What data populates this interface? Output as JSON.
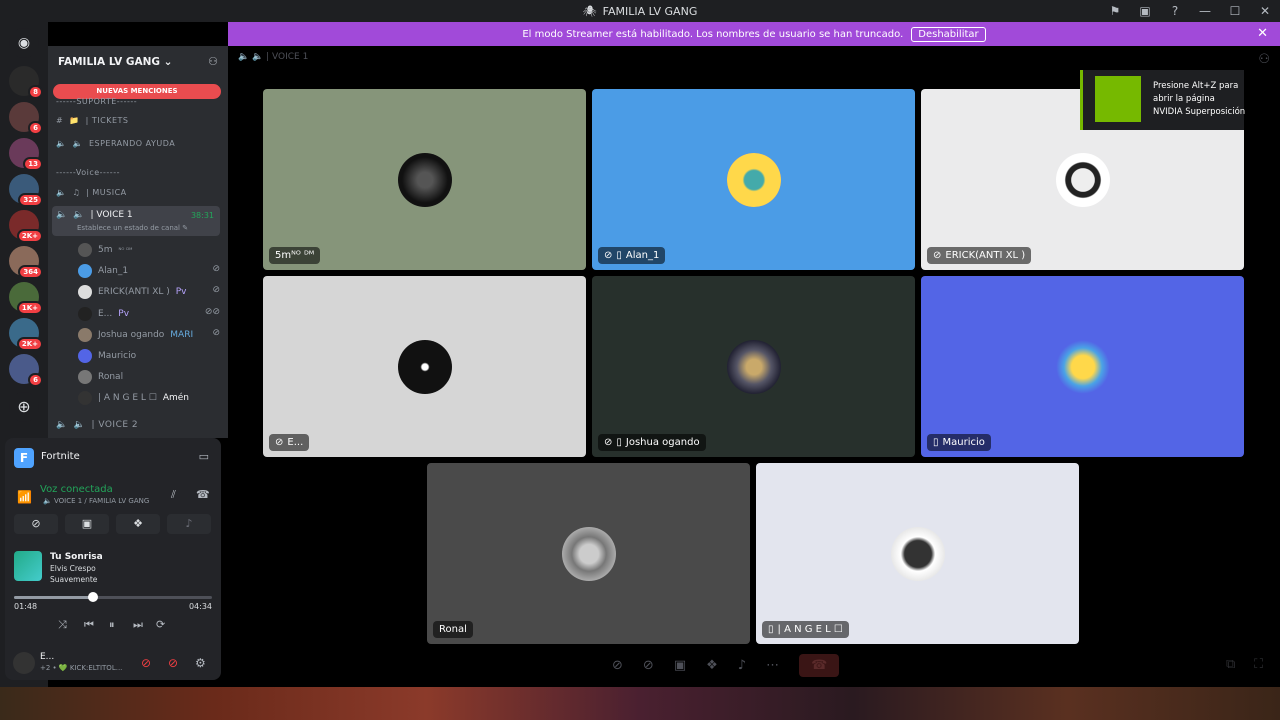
{
  "window": {
    "title": "FAMILIA LV GANG"
  },
  "banner": {
    "text": "El modo Streamer está habilitado. Los nombres de usuario se han truncado.",
    "button": "Deshabilitar"
  },
  "guild_badges": [
    "8",
    "6",
    "13",
    "325",
    "2K+",
    "364",
    "1K+",
    "2K+",
    "6"
  ],
  "server": {
    "name": "FAMILIA LV GANG",
    "new_mentions": "NUEVAS MENCIONES"
  },
  "channels": {
    "category1": "------SUPORTE------",
    "tickets": "| TICKETS",
    "esperando": "ESPERANDO AYUDA",
    "category2": "------Voice------",
    "musica": "| MUSICA",
    "voice1": "| VOICE 1",
    "voice1_time": "38:31",
    "voice1_status": "Establece un estado de canal",
    "voice2": "| VOICE 2"
  },
  "members": [
    {
      "name": "5m",
      "tag": "ᴺᴼ ᴰᴹ"
    },
    {
      "name": "Alan_1",
      "tag": ""
    },
    {
      "name": "ERICK(ANTI XL )",
      "tag": "Pv"
    },
    {
      "name": "E...",
      "tag": "Pv"
    },
    {
      "name": "Joshua ogando",
      "tag": "MARI"
    },
    {
      "name": "Mauricio",
      "tag": ""
    },
    {
      "name": "Ronal",
      "tag": ""
    },
    {
      "name": "| A N G E L ☐",
      "tag": "Amén"
    }
  ],
  "activity": {
    "game": "Fortnite"
  },
  "voice": {
    "status": "Voz conectada",
    "channel": "VOICE 1 / FAMILIA LV GANG"
  },
  "music": {
    "title": "Tu Sonrisa",
    "artist": "Elvis Crespo",
    "album": "Suavemente",
    "current": "01:48",
    "total": "04:34",
    "progress": 0.4
  },
  "user": {
    "name": "E...",
    "status": "+2 • 💚 KICK:ELTITOL..."
  },
  "top_channel": "| VOICE 1",
  "tiles": [
    {
      "label": "5mᴺᴼ ᴰᴹ",
      "color": "#86957a"
    },
    {
      "label": "Alan_1",
      "color": "#4b9ce6"
    },
    {
      "label": "ERICK(ANTI XL )",
      "color": "#ebebec"
    },
    {
      "label": "E...",
      "color": "#d6d6d6"
    },
    {
      "label": "Joshua ogando",
      "color": "#27302c"
    },
    {
      "label": "Mauricio",
      "color": "#5365e6"
    },
    {
      "label": "Ronal",
      "color": "#4a4a4a"
    },
    {
      "label": "| A N G E L ☐",
      "color": "#e3e5ee"
    }
  ],
  "nvidia": {
    "text": "Presione Alt+Z para abrir la página NVIDIA Superposición"
  }
}
